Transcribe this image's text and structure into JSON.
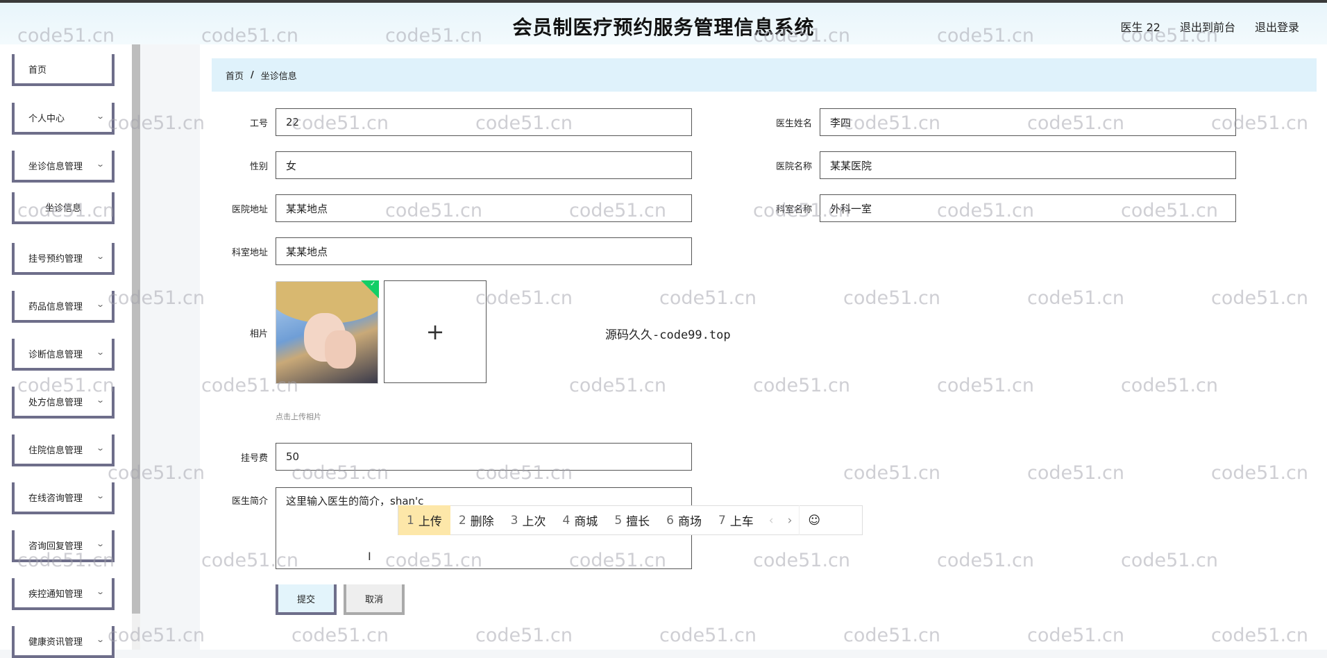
{
  "header": {
    "title": "会员制医疗预约服务管理信息系统",
    "user_label": "医生 22",
    "back_front": "退出到前台",
    "logout": "退出登录"
  },
  "sidebar": {
    "items": [
      {
        "label": "首页",
        "expandable": false
      },
      {
        "label": "个人中心",
        "expandable": true
      },
      {
        "label": "坐诊信息管理",
        "expandable": true
      },
      {
        "label": "坐诊信息",
        "expandable": false,
        "sub": true
      },
      {
        "label": "挂号预约管理",
        "expandable": true
      },
      {
        "label": "药品信息管理",
        "expandable": true
      },
      {
        "label": "诊断信息管理",
        "expandable": true
      },
      {
        "label": "处方信息管理",
        "expandable": true
      },
      {
        "label": "住院信息管理",
        "expandable": true
      },
      {
        "label": "在线咨询管理",
        "expandable": true
      },
      {
        "label": "咨询回复管理",
        "expandable": true
      },
      {
        "label": "疾控通知管理",
        "expandable": true
      },
      {
        "label": "健康资讯管理",
        "expandable": true
      }
    ]
  },
  "breadcrumb": {
    "home": "首页",
    "separator": "/",
    "current": "坐诊信息"
  },
  "form": {
    "job_no": {
      "label": "工号",
      "value": "22"
    },
    "doctor_name": {
      "label": "医生姓名",
      "value": "李四"
    },
    "gender": {
      "label": "性别",
      "value": "女"
    },
    "hospital_name": {
      "label": "医院名称",
      "value": "某某医院"
    },
    "hospital_address": {
      "label": "医院地址",
      "value": "某某地点"
    },
    "dept_name": {
      "label": "科室名称",
      "value": "外科一室"
    },
    "dept_address": {
      "label": "科室地址",
      "value": "某某地点"
    },
    "photo": {
      "label": "相片",
      "upload_symbol": "+",
      "hint": "点击上传相片"
    },
    "fee": {
      "label": "挂号费",
      "value": "50"
    },
    "intro": {
      "label": "医生简介",
      "value": "这里输入医生的简介，shan'c"
    },
    "submit": "提交",
    "cancel": "取消"
  },
  "overlay_text": "源码久久-code99.top",
  "ime": {
    "candidates": [
      {
        "n": "1",
        "text": "上传"
      },
      {
        "n": "2",
        "text": "删除"
      },
      {
        "n": "3",
        "text": "上次"
      },
      {
        "n": "4",
        "text": "商城"
      },
      {
        "n": "5",
        "text": "擅长"
      },
      {
        "n": "6",
        "text": "商场"
      },
      {
        "n": "7",
        "text": "上车"
      }
    ],
    "prev": "‹",
    "next": "›",
    "emoji": "☺"
  },
  "watermark": "code51.cn",
  "colors": {
    "accent_bg": "#dff2fb",
    "menu_border": "#6e6e8a",
    "ime_active": "#fde7a9",
    "check_green": "#13ce66"
  }
}
